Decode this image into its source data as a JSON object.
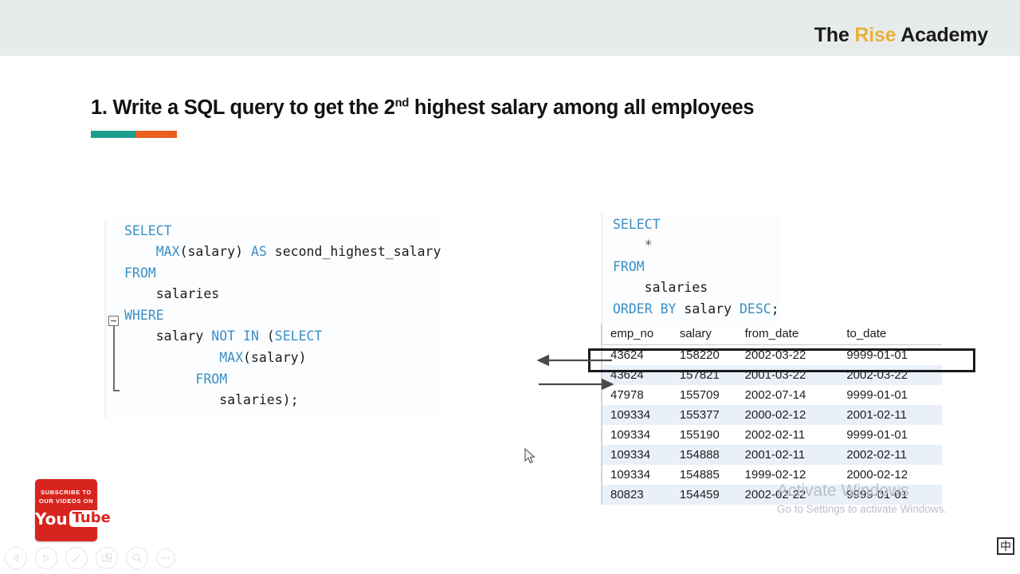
{
  "header": {
    "brand_prefix": "The ",
    "brand_accent": "Rise",
    "brand_suffix": " Academy"
  },
  "slide": {
    "title_before": "1. Write a SQL query to get the 2",
    "title_sup": "nd",
    "title_after": " highest salary among all employees",
    "rule_color_left": "#1c9e8e",
    "rule_color_right": "#e8601c"
  },
  "code_left": {
    "name": "second-highest-salary-query",
    "lines": [
      [
        {
          "t": "SELECT",
          "k": true
        }
      ],
      [
        {
          "t": "    ",
          "k": false
        },
        {
          "t": "MAX",
          "k": true
        },
        {
          "t": "(salary) ",
          "k": false
        },
        {
          "t": "AS",
          "k": true
        },
        {
          "t": " second_highest_salary",
          "k": false
        }
      ],
      [
        {
          "t": "FROM",
          "k": true
        }
      ],
      [
        {
          "t": "    salaries",
          "k": false
        }
      ],
      [
        {
          "t": "WHERE",
          "k": true
        }
      ],
      [
        {
          "t": "    salary ",
          "k": false
        },
        {
          "t": "NOT IN",
          "k": true
        },
        {
          "t": " (",
          "k": false
        },
        {
          "t": "SELECT",
          "k": true
        }
      ],
      [
        {
          "t": "            ",
          "k": false
        },
        {
          "t": "MAX",
          "k": true
        },
        {
          "t": "(salary)",
          "k": false
        }
      ],
      [
        {
          "t": "         ",
          "k": false
        },
        {
          "t": "FROM",
          "k": true
        }
      ],
      [
        {
          "t": "            salaries);",
          "k": false
        }
      ]
    ],
    "plain_text": "SELECT\n    MAX(salary) AS second_highest_salary\nFROM\n    salaries\nWHERE\n    salary NOT IN (SELECT\n            MAX(salary)\n         FROM\n            salaries);"
  },
  "code_right": {
    "name": "order-by-salary-query",
    "lines": [
      [
        {
          "t": "SELECT",
          "k": true
        }
      ],
      [
        {
          "t": "    *",
          "k": false
        }
      ],
      [
        {
          "t": "FROM",
          "k": true
        }
      ],
      [
        {
          "t": "    salaries",
          "k": false
        }
      ],
      [
        {
          "t": "ORDER BY",
          "k": true
        },
        {
          "t": " salary ",
          "k": false
        },
        {
          "t": "DESC",
          "k": true
        },
        {
          "t": ";",
          "k": false
        }
      ]
    ],
    "plain_text": "SELECT\n    *\nFROM\n    salaries\nORDER BY salary DESC;"
  },
  "result_table": {
    "columns": [
      "emp_no",
      "salary",
      "from_date",
      "to_date"
    ],
    "rows": [
      [
        "43624",
        "158220",
        "2002-03-22",
        "9999-01-01"
      ],
      [
        "43624",
        "157821",
        "2001-03-22",
        "2002-03-22"
      ],
      [
        "47978",
        "155709",
        "2002-07-14",
        "9999-01-01"
      ],
      [
        "109334",
        "155377",
        "2000-02-12",
        "2001-02-11"
      ],
      [
        "109334",
        "155190",
        "2002-02-11",
        "9999-01-01"
      ],
      [
        "109334",
        "154888",
        "2001-02-11",
        "2002-02-11"
      ],
      [
        "109334",
        "154885",
        "1999-02-12",
        "2000-02-12"
      ],
      [
        "80823",
        "154459",
        "2002-02-22",
        "9999-01-01"
      ]
    ],
    "highlighted_row_index": 0,
    "alt_row_color": "#eaf0f9"
  },
  "annotations": {
    "arrow_out_label": "arrow pointing left from highlighted row",
    "arrow_in_label": "arrow pointing right to second row"
  },
  "watermark": {
    "title": "Activate Windows",
    "subtitle": "Go to Settings to activate Windows."
  },
  "youtube_badge": {
    "line1": "SUBSCRIBE TO",
    "line2": "OUR VIDEOS ON",
    "logo_you": "You",
    "logo_tube": "Tube"
  },
  "toolbar": {
    "buttons": [
      {
        "name": "previous-slide-button",
        "icon": "triangle-left-icon"
      },
      {
        "name": "next-slide-button",
        "icon": "triangle-right-icon"
      },
      {
        "name": "pen-button",
        "icon": "pen-icon"
      },
      {
        "name": "slide-overview-button",
        "icon": "slides-icon"
      },
      {
        "name": "zoom-button",
        "icon": "magnifier-icon"
      },
      {
        "name": "more-options-button",
        "icon": "ellipsis-icon"
      }
    ]
  },
  "ime": {
    "label": "中"
  }
}
